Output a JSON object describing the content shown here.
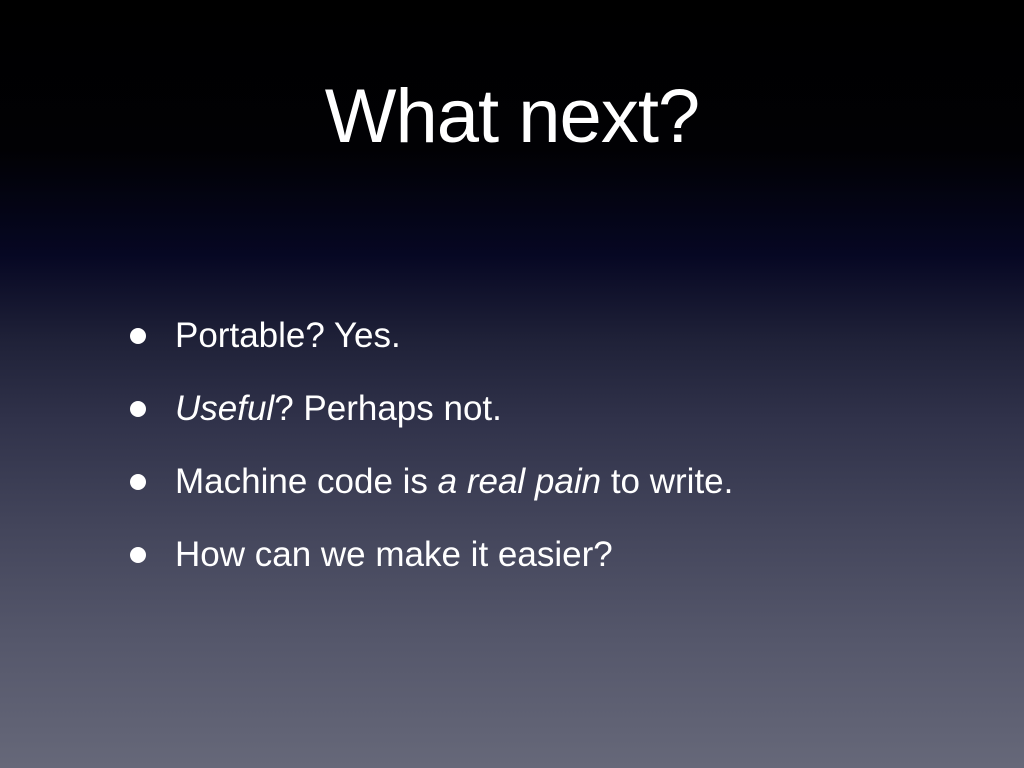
{
  "slide": {
    "title": "What next?",
    "bullets": [
      {
        "parts": [
          {
            "text": "Portable? Yes.",
            "italic": false
          }
        ]
      },
      {
        "parts": [
          {
            "text": "Useful",
            "italic": true
          },
          {
            "text": "? Perhaps not.",
            "italic": false
          }
        ]
      },
      {
        "parts": [
          {
            "text": "Machine code is ",
            "italic": false
          },
          {
            "text": "a real pain",
            "italic": true
          },
          {
            "text": " to write.",
            "italic": false
          }
        ]
      },
      {
        "parts": [
          {
            "text": "How can we make it easier?",
            "italic": false
          }
        ]
      }
    ]
  }
}
